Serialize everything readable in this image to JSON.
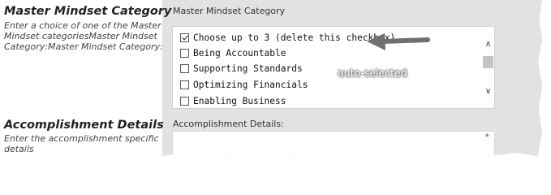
{
  "sections": {
    "mindset": {
      "title": "Master Mindset Category",
      "description": "Enter a choice of one of the Master Mindset categoriesMaster Mindset Category:Master Mindset Category:",
      "field_label": "Master Mindset Category",
      "options": [
        {
          "label": "Choose up to 3 (delete this checkbox)",
          "checked": true
        },
        {
          "label": "Being Accountable",
          "checked": false
        },
        {
          "label": "Supporting Standards",
          "checked": false
        },
        {
          "label": "Optimizing Financials",
          "checked": false
        },
        {
          "label": "Enabling Business",
          "checked": false
        }
      ],
      "annotation": "auto-selected"
    },
    "accomplishment": {
      "title": "Accomplishment Details",
      "description": "Enter the accomplishment specific details",
      "field_label": "Accomplishment Details:",
      "input_value": "",
      "required_marker": "*"
    }
  },
  "scrollbar": {
    "up_glyph": "∧",
    "down_glyph": "∨"
  },
  "colors": {
    "panel": "#e2e2e2",
    "arrow": "#707070",
    "annotation_text": "#ffffff"
  },
  "icons": {
    "annotation_arrow": "arrow-left-icon"
  }
}
